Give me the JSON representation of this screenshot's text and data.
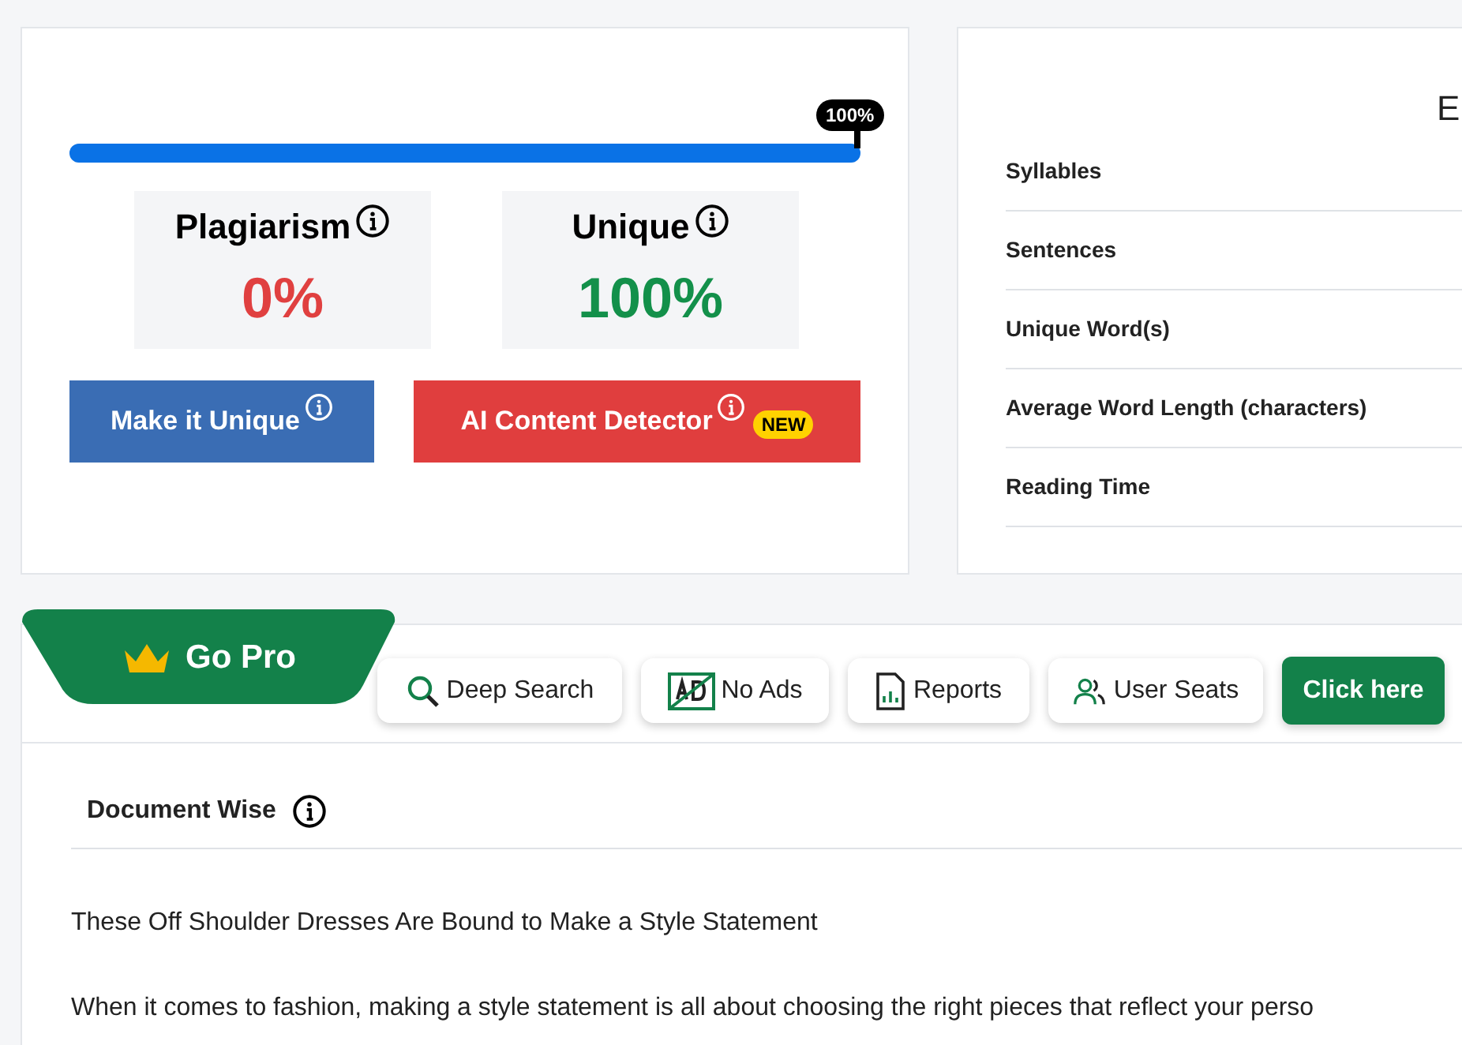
{
  "progress": {
    "level": 1,
    "label": "100%"
  },
  "scores": [
    {
      "kind": "plagiarism",
      "label": "Plagiarism",
      "value": "0%"
    },
    {
      "kind": "unique",
      "label": "Unique",
      "value": "100%"
    }
  ],
  "actions": [
    {
      "kind": "make_unique",
      "label": "Make it Unique"
    },
    {
      "kind": "ai_detector",
      "label": "AI Content Detector",
      "badge": "NEW"
    }
  ],
  "stats": {
    "heading": "E",
    "rows": [
      "Syllables",
      "Sentences",
      "Unique Word(s)",
      "Average Word Length (characters)",
      "Reading Time"
    ]
  },
  "pro": {
    "title": "Go Pro",
    "features": [
      {
        "kind": "search",
        "label": "Deep Search"
      },
      {
        "kind": "noads",
        "label": "No Ads"
      },
      {
        "kind": "reports",
        "label": "Reports"
      },
      {
        "kind": "seats",
        "label": "User Seats"
      }
    ],
    "button": "Click here"
  },
  "document": {
    "tab": "Document Wise",
    "paragraphs": [
      "These Off Shoulder Dresses Are Bound to Make a Style Statement",
      "When it comes to fashion, making a style statement is all about choosing the right pieces that reflect your perso"
    ]
  }
}
